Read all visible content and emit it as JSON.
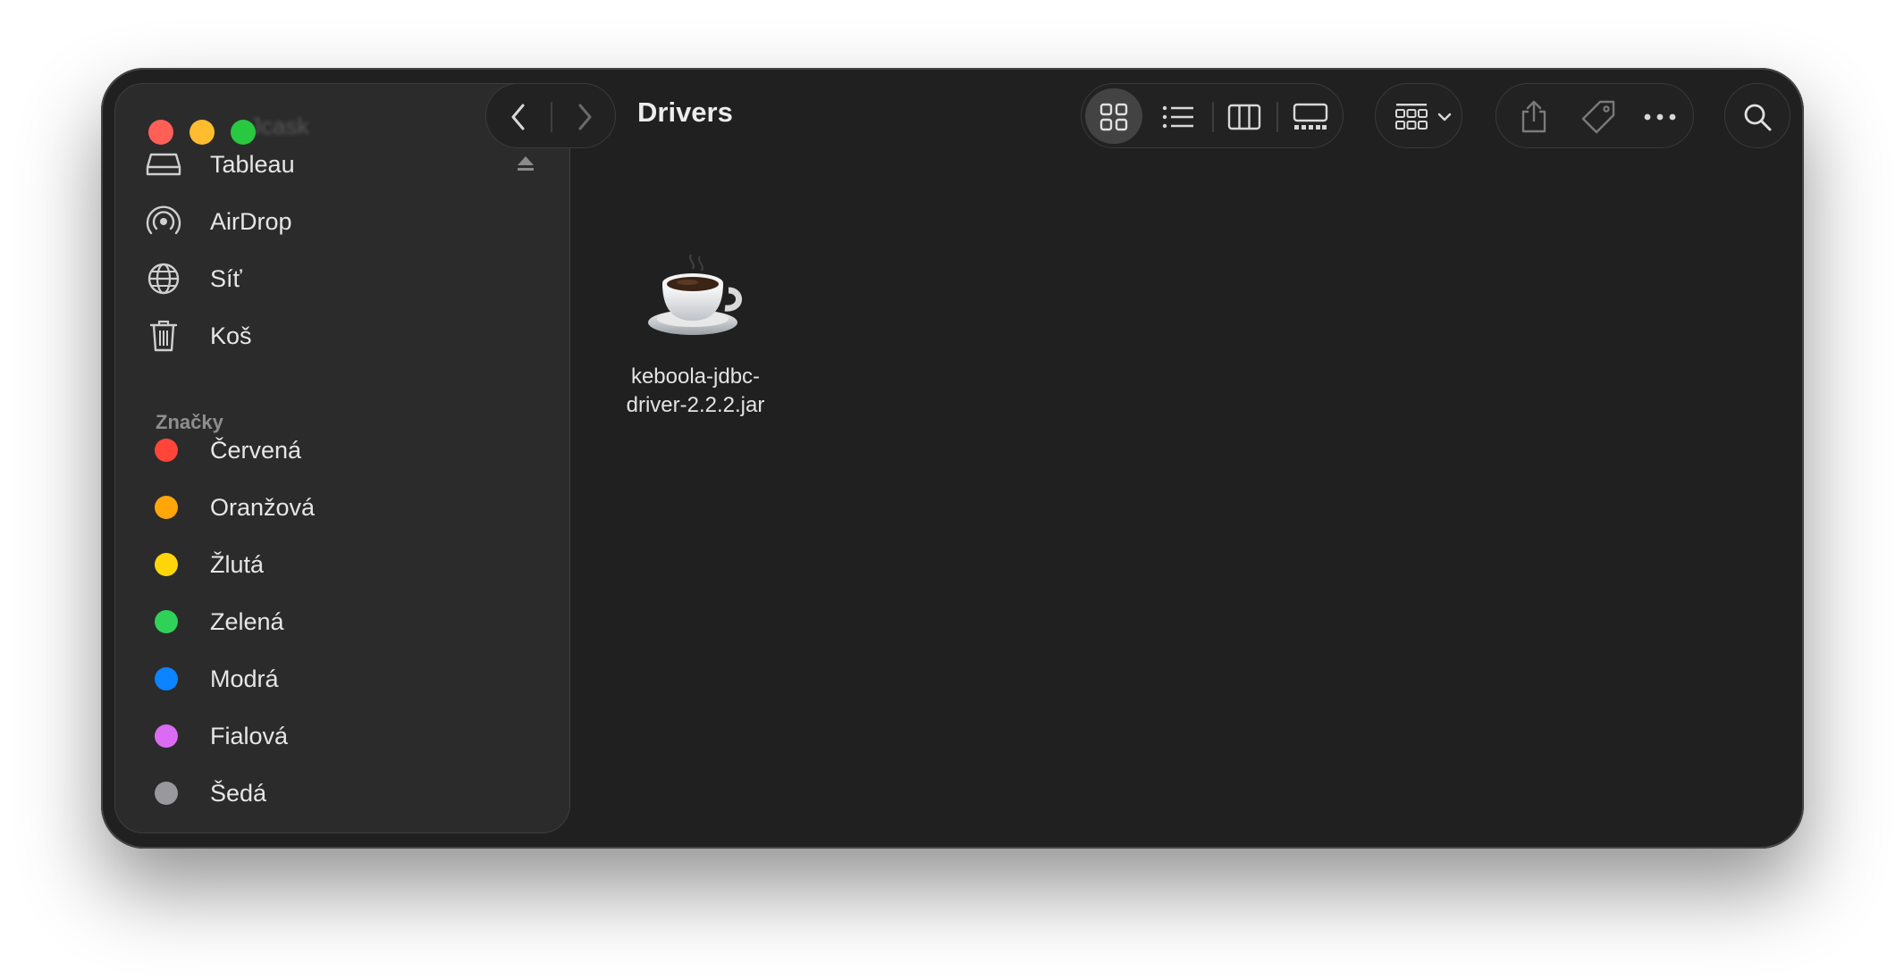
{
  "window": {
    "title": "Drivers"
  },
  "sidebar": {
    "ghost_label": "Jcask",
    "locations": [
      {
        "label": "Tableau",
        "icon": "drive-icon"
      },
      {
        "label": "AirDrop",
        "icon": "airdrop-icon"
      },
      {
        "label": "Síť",
        "icon": "network-globe-icon"
      },
      {
        "label": "Koš",
        "icon": "trash-icon"
      }
    ],
    "tags_header": "Značky",
    "tags": [
      {
        "label": "Červená",
        "color": "#ff453a"
      },
      {
        "label": "Oranžová",
        "color": "#ffa60a"
      },
      {
        "label": "Žlutá",
        "color": "#ffd60a"
      },
      {
        "label": "Zelená",
        "color": "#30d158"
      },
      {
        "label": "Modrá",
        "color": "#0a84ff"
      },
      {
        "label": "Fialová",
        "color": "#da6bf2"
      },
      {
        "label": "Šedá",
        "color": "#98989d"
      }
    ]
  },
  "toolbar": {
    "view_modes": [
      "icon-view",
      "list-view",
      "column-view",
      "gallery-view"
    ],
    "selected_view": "icon-view"
  },
  "files": [
    {
      "name": "keboola-jdbc-driver-2.2.2.jar",
      "name_line1": "keboola-jdbc-",
      "name_line2": "driver-2.2.2.jar",
      "icon": "java-coffee-cup-icon"
    }
  ]
}
